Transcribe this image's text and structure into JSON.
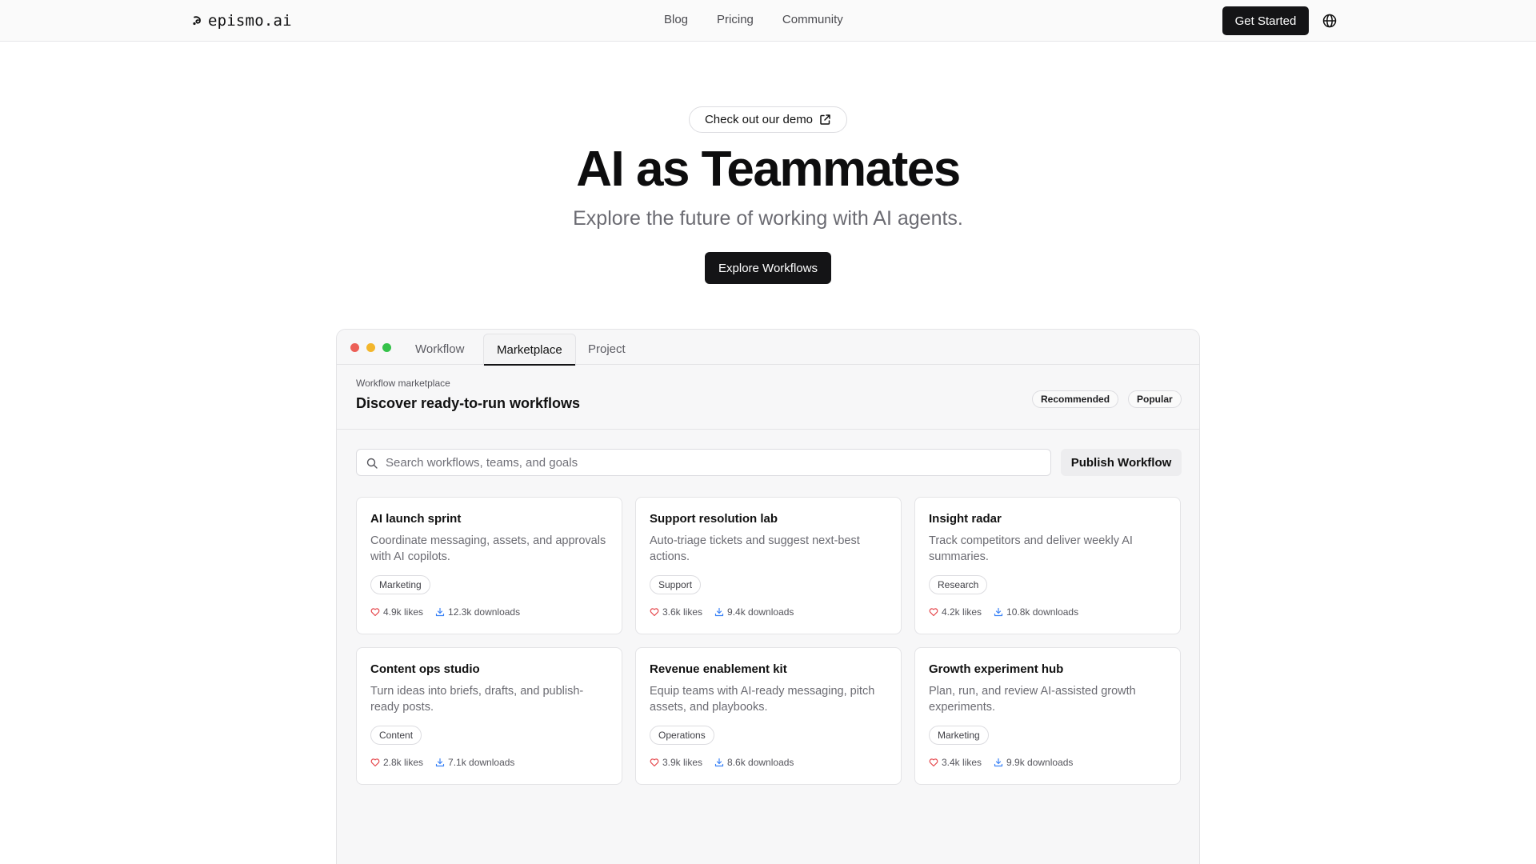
{
  "nav": {
    "brand": "epismo.ai",
    "links": [
      "Blog",
      "Pricing",
      "Community"
    ],
    "cta": "Get Started",
    "icons": [
      "brand-logo-icon",
      "globe-icon"
    ]
  },
  "hero": {
    "demo_label": "Check out our demo",
    "title": "AI as Teammates",
    "subtitle": "Explore the future of working with AI agents.",
    "cta": "Explore Workflows"
  },
  "window": {
    "tabs": [
      {
        "label": "Workflow",
        "active": false
      },
      {
        "label": "Marketplace",
        "active": true
      },
      {
        "label": "Project",
        "active": false
      }
    ],
    "marketplace": {
      "eyebrow": "Workflow marketplace",
      "title": "Discover ready-to-run workflows",
      "filters": [
        "Recommended",
        "Popular"
      ],
      "search_placeholder": "Search workflows, teams, and goals",
      "publish_label": "Publish Workflow",
      "cards": [
        {
          "title": "AI launch sprint",
          "desc": "Coordinate messaging, assets, and approvals with AI copilots.",
          "tag": "Marketing",
          "likes": "4.9k likes",
          "downloads": "12.3k downloads"
        },
        {
          "title": "Support resolution lab",
          "desc": "Auto-triage tickets and suggest next-best actions.",
          "tag": "Support",
          "likes": "3.6k likes",
          "downloads": "9.4k downloads"
        },
        {
          "title": "Insight radar",
          "desc": "Track competitors and deliver weekly AI summaries.",
          "tag": "Research",
          "likes": "4.2k likes",
          "downloads": "10.8k downloads"
        },
        {
          "title": "Content ops studio",
          "desc": "Turn ideas into briefs, drafts, and publish-ready posts.",
          "tag": "Content",
          "likes": "2.8k likes",
          "downloads": "7.1k downloads"
        },
        {
          "title": "Revenue enablement kit",
          "desc": "Equip teams with AI-ready messaging, pitch assets, and playbooks.",
          "tag": "Operations",
          "likes": "3.9k likes",
          "downloads": "8.6k downloads"
        },
        {
          "title": "Growth experiment hub",
          "desc": "Plan, run, and review AI-assisted growth experiments.",
          "tag": "Marketing",
          "likes": "3.4k likes",
          "downloads": "9.9k downloads"
        }
      ]
    }
  },
  "colors": {
    "primary_button": "#141416",
    "like_icon": "#e5484d",
    "download_icon": "#3b82f6",
    "window_dot_red": "#ec5f57",
    "window_dot_yellow": "#f3b62c",
    "window_dot_green": "#35c24a"
  }
}
